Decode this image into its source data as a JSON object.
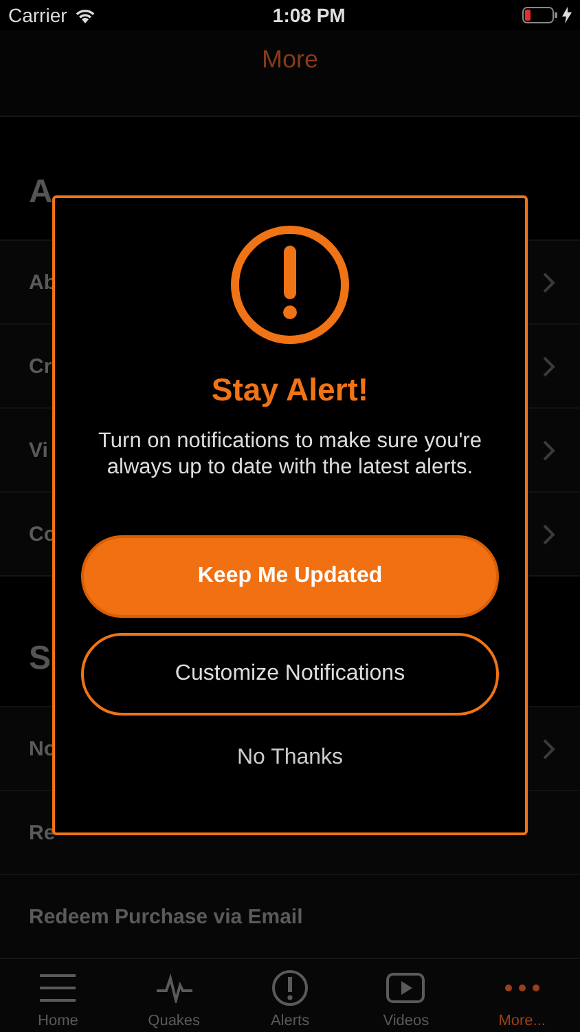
{
  "status_bar": {
    "carrier": "Carrier",
    "time": "1:08 PM"
  },
  "nav": {
    "title": "More"
  },
  "sections": [
    {
      "header": "A",
      "rows": [
        {
          "label": "Ab",
          "chevron": true
        },
        {
          "label": "Cr",
          "chevron": true
        },
        {
          "label": "Vi",
          "chevron": true
        },
        {
          "label": "Co",
          "chevron": true
        }
      ]
    },
    {
      "header": "S",
      "rows": [
        {
          "label": "No",
          "chevron": true
        },
        {
          "label": "Re",
          "chevron": false
        },
        {
          "label": "Redeem Purchase via Email",
          "chevron": false
        }
      ]
    }
  ],
  "dialog": {
    "title": "Stay Alert!",
    "message": "Turn on notifications to make sure you're always up to date with the latest alerts.",
    "buttons": [
      {
        "label": "Keep Me Updated",
        "kind": "filled"
      },
      {
        "label": "Customize Notifications",
        "kind": "outline"
      },
      {
        "label": "No Thanks",
        "kind": "plain"
      }
    ]
  },
  "tab_bar": [
    {
      "label": "Home",
      "selected": false
    },
    {
      "label": "Quakes",
      "selected": false
    },
    {
      "label": "Alerts",
      "selected": false
    },
    {
      "label": "Videos",
      "selected": false
    },
    {
      "label": "More...",
      "selected": true
    }
  ]
}
